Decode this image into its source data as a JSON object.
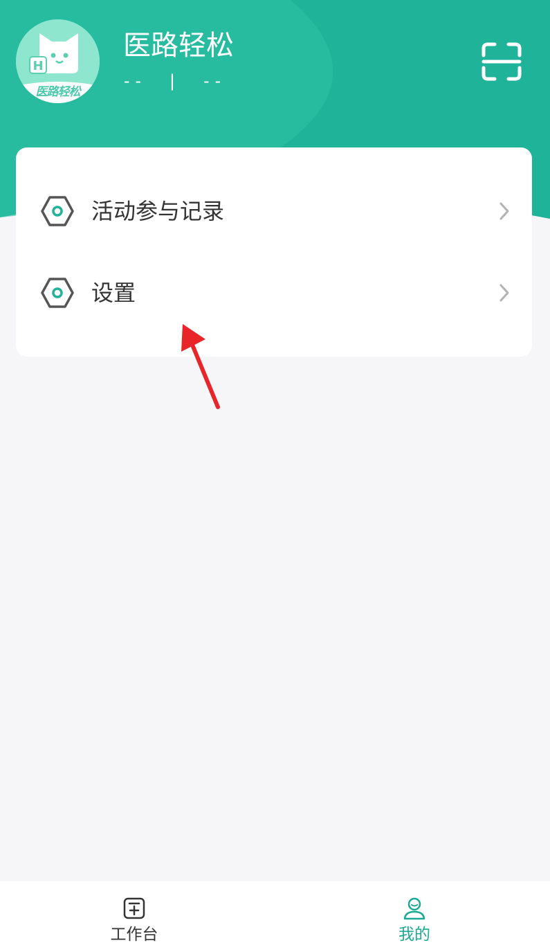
{
  "header": {
    "app_title": "医路轻松",
    "subtitle": "--  |  --",
    "avatar_logo_text": "医路轻松",
    "avatar_badge_letter": "H",
    "scan_icon": "scan-icon"
  },
  "menu": {
    "items": [
      {
        "label": "活动参与记录",
        "icon": "hexagon-icon",
        "trailing_icon": "chevron-right-icon"
      },
      {
        "label": "设置",
        "icon": "hexagon-icon",
        "trailing_icon": "chevron-right-icon"
      }
    ]
  },
  "bottom_nav": {
    "tabs": [
      {
        "label": "工作台",
        "icon": "workbench-icon",
        "active": false
      },
      {
        "label": "我的",
        "icon": "profile-icon",
        "active": true
      }
    ]
  },
  "colors": {
    "brand_teal": "#1fb39a",
    "header_light": "#2ec3a4",
    "page_bg": "#f6f6f8",
    "active_tab": "#1aaa94",
    "inactive_tab": "#333333",
    "annotation_red": "#e8262a"
  }
}
